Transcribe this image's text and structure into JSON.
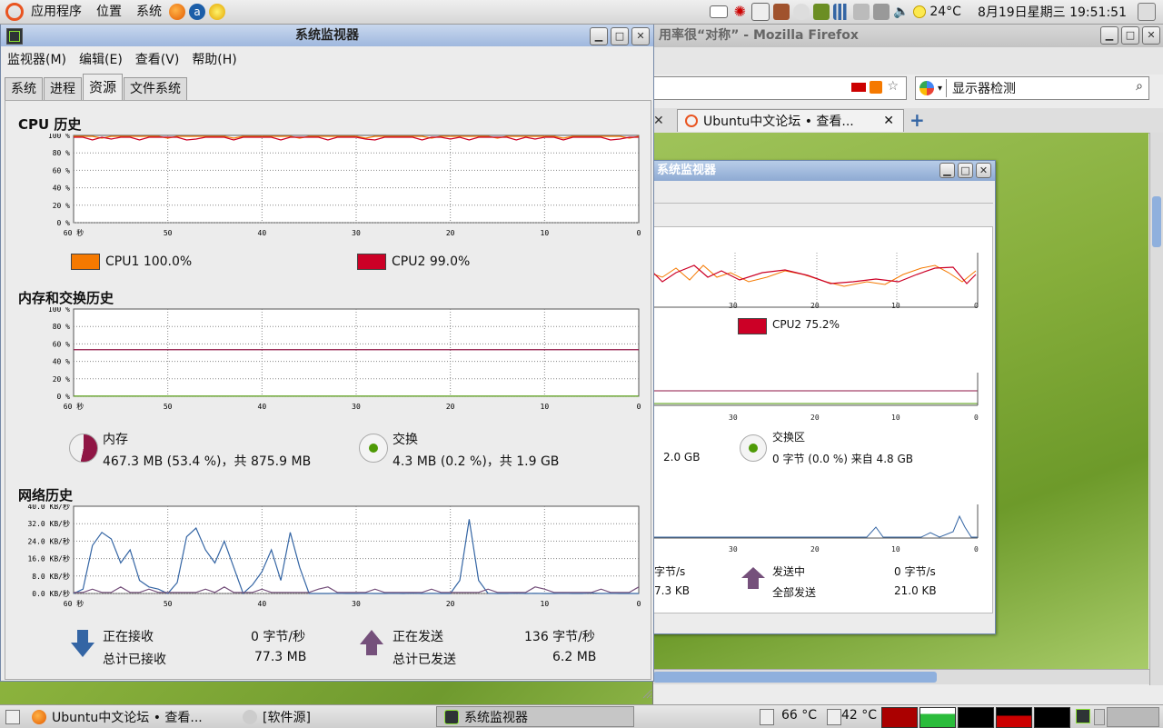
{
  "top_panel": {
    "menus": [
      "应用程序",
      "位置",
      "系统"
    ],
    "weather": "24°C",
    "clock": "8月19日星期三 19:51:51"
  },
  "firefox": {
    "title": "用率很“对称” - Mozilla Firefox",
    "search_value": "显示器检测",
    "tab_label": "Ubuntu中文论坛 • 查看...",
    "inner_window": {
      "title": "系统监视器",
      "cpu2_legend": "CPU2  75.2%",
      "swap_label": "交换区",
      "swap_value": "0 字节 (0.0 %) 来自  4.8 GB",
      "mem_total_fragment": "2.0 GB",
      "sending_label": "发送中",
      "sending_value": "0 字节/s",
      "total_sent_label": "全部发送",
      "total_sent_value": "21.0 KB",
      "recv_rate_fragment": "字节/s",
      "recv_total_fragment": "7.3 KB",
      "x_ticks": [
        "30",
        "20",
        "10",
        "0"
      ]
    }
  },
  "system_monitor": {
    "title": "系统监视器",
    "menus": [
      "监视器(M)",
      "编辑(E)",
      "查看(V)",
      "帮助(H)"
    ],
    "tabs": [
      "系统",
      "进程",
      "资源",
      "文件系统"
    ],
    "selected_tab": "资源",
    "cpu": {
      "title": "CPU 历史",
      "y_ticks": [
        "100 %",
        "80 %",
        "60 %",
        "40 %",
        "20 %",
        "0 %"
      ],
      "x_ticks": [
        "60 秒",
        "50",
        "40",
        "30",
        "20",
        "10",
        "0"
      ],
      "legend": [
        {
          "label": "CPU1  100.0%",
          "color": "#f57900"
        },
        {
          "label": "CPU2  99.0%",
          "color": "#cc0026"
        }
      ]
    },
    "memory": {
      "title": "内存和交换历史",
      "y_ticks": [
        "100 %",
        "80 %",
        "60 %",
        "40 %",
        "20 %",
        "0 %"
      ],
      "x_ticks": [
        "60 秒",
        "50",
        "40",
        "30",
        "20",
        "10",
        "0"
      ],
      "mem_label": "内存",
      "mem_value": "467.3 MB (53.4 %)，共 875.9 MB",
      "swap_label": "交换",
      "swap_value": "4.3 MB (0.2 %)，共 1.9 GB",
      "mem_color": "#8f1544",
      "swap_color": "#4e9a06"
    },
    "network": {
      "title": "网络历史",
      "y_ticks": [
        "40.0 KB/秒",
        "32.0 KB/秒",
        "24.0 KB/秒",
        "16.0 KB/秒",
        "8.0 KB/秒",
        "0.0 KB/秒"
      ],
      "x_ticks": [
        "60 秒",
        "50",
        "40",
        "30",
        "20",
        "10",
        "0"
      ],
      "receiving_label": "正在接收",
      "receiving_value": "0 字节/秒",
      "total_received_label": "总计已接收",
      "total_received_value": "77.3 MB",
      "sending_label": "正在发送",
      "sending_value": "136 字节/秒",
      "total_sent_label": "总计已发送",
      "total_sent_value": "6.2 MB",
      "recv_color": "#3465a4",
      "send_color": "#75507b"
    }
  },
  "taskbar": {
    "items": [
      "Ubuntu中文论坛 • 查看...",
      "[软件源]",
      "系统监视器"
    ],
    "temp1": "66 °C",
    "temp2": "42 °C"
  }
}
